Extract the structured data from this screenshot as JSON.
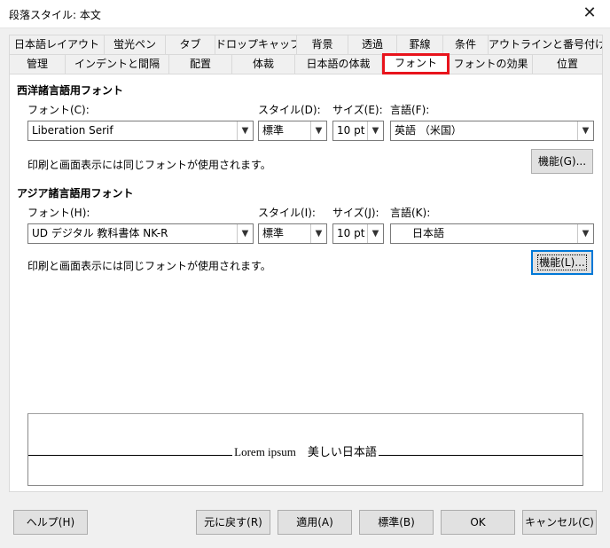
{
  "window": {
    "title": "段落スタイル: 本文",
    "close_glyph": "✕"
  },
  "tabs": {
    "back_row": [
      "日本語レイアウト",
      "蛍光ペン",
      "タブ",
      "ドロップキャップ",
      "背景",
      "透過",
      "罫線",
      "条件",
      "アウトラインと番号付け"
    ],
    "front_row": [
      "管理",
      "インデントと間隔",
      "配置",
      "体裁",
      "日本語の体裁",
      "フォント",
      "フォントの効果",
      "位置"
    ],
    "selected": "フォント"
  },
  "western": {
    "heading": "西洋諸言語用フォント",
    "font_label": "フォント(C):",
    "font_value": "Liberation Serif",
    "style_label": "スタイル(D):",
    "style_value": "標準",
    "size_label": "サイズ(E):",
    "size_value": "10 pt",
    "lang_label": "言語(F):",
    "lang_value": "英語 （米国）",
    "note": "印刷と画面表示には同じフォントが使用されます。",
    "features_button": "機能(G)..."
  },
  "asian": {
    "heading": "アジア諸言語用フォント",
    "font_label": "フォント(H):",
    "font_value": "UD デジタル 教科書体 NK-R",
    "style_label": "スタイル(I):",
    "style_value": "標準",
    "size_label": "サイズ(J):",
    "size_value": "10 pt",
    "lang_label": "言語(K):",
    "lang_value": "日本語",
    "note": "印刷と画面表示には同じフォントが使用されます。",
    "features_button": "機能(L)..."
  },
  "preview": {
    "text": "Lorem ipsum　美しい日本語"
  },
  "footer": {
    "help": "ヘルプ(H)",
    "reset": "元に戻す(R)",
    "apply": "適用(A)",
    "standard": "標準(B)",
    "ok": "OK",
    "cancel": "キャンセル(C)"
  },
  "colors": {
    "selected_tab_border": "#e8141c",
    "focus": "#0078d7"
  }
}
